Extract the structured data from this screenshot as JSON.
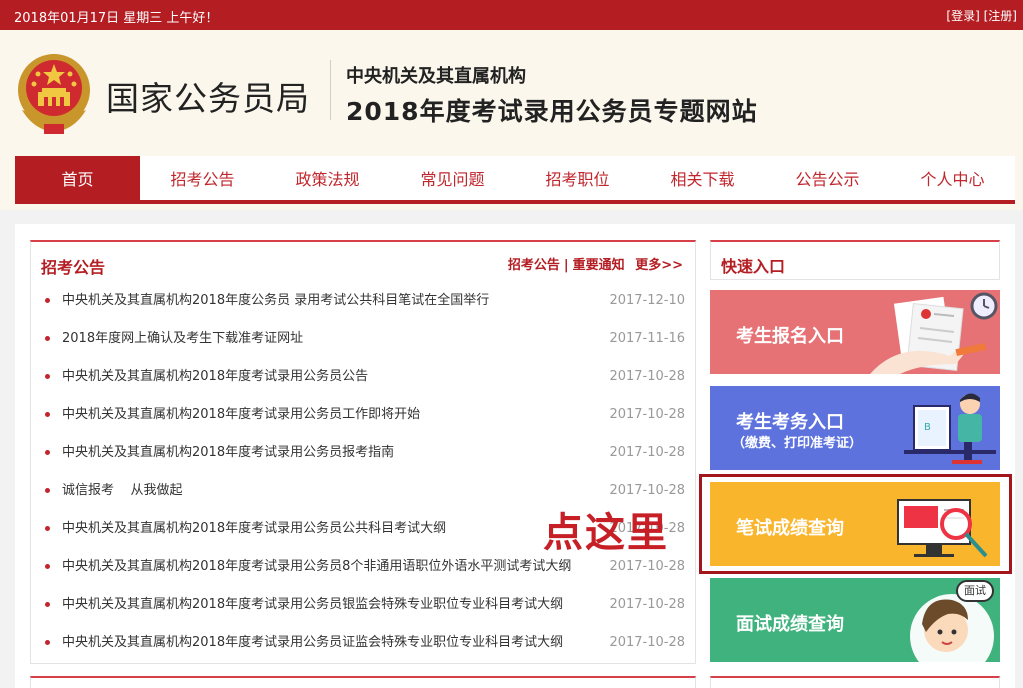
{
  "topbar": {
    "date_text": "2018年01月17日  星期三  上午好！",
    "login_label": "[登录]",
    "register_label": "[注册]"
  },
  "header": {
    "site_name": "国家公务员局",
    "sub_title": "中央机关及其直属机构",
    "main_title": "2018年度考试录用公务员专题网站"
  },
  "nav": {
    "items": [
      "首页",
      "招考公告",
      "政策法规",
      "常见问题",
      "招考职位",
      "相关下载",
      "公告公示",
      "个人中心"
    ]
  },
  "news": {
    "heading": "招考公告",
    "link_notice": "招考公告",
    "link_important": "重要通知",
    "link_more": "更多>>",
    "items": [
      {
        "title": "中央机关及其直属机构2018年度公务员 录用考试公共科目笔试在全国举行",
        "date": "2017-12-10"
      },
      {
        "title": "2018年度网上确认及考生下载准考证网址",
        "date": "2017-11-16"
      },
      {
        "title": "中央机关及其直属机构2018年度考试录用公务员公告",
        "date": "2017-10-28"
      },
      {
        "title": "中央机关及其直属机构2018年度考试录用公务员工作即将开始",
        "date": "2017-10-28"
      },
      {
        "title": "中央机关及其直属机构2018年度考试录用公务员报考指南",
        "date": "2017-10-28"
      },
      {
        "title": "诚信报考    从我做起",
        "date": "2017-10-28"
      },
      {
        "title": "中央机关及其直属机构2018年度考试录用公务员公共科目考试大纲",
        "date": "2017-10-28"
      },
      {
        "title": "中央机关及其直属机构2018年度考试录用公务员8个非通用语职位外语水平测试考试大纲",
        "date": "2017-10-28"
      },
      {
        "title": "中央机关及其直属机构2018年度考试录用公务员银监会特殊专业职位专业科目考试大纲",
        "date": "2017-10-28"
      },
      {
        "title": "中央机关及其直属机构2018年度考试录用公务员证监会特殊专业职位专业科目考试大纲",
        "date": "2017-10-28"
      }
    ]
  },
  "quick": {
    "heading": "快速入口",
    "register_entry": "考生报名入口",
    "exam_entry": "考生考务入口",
    "exam_entry_note": "（缴费、打印准考证）",
    "written_score": "笔试成绩查询",
    "interview_score": "面试成绩查询",
    "interview_badge": "面试"
  },
  "annotation": {
    "click_here": "点这里"
  },
  "colors": {
    "brand_red": "#b41e23",
    "register_bg": "#e67275",
    "exam_bg": "#5d72dd",
    "written_bg": "#f9b52c",
    "interview_bg": "#3fb27e"
  }
}
